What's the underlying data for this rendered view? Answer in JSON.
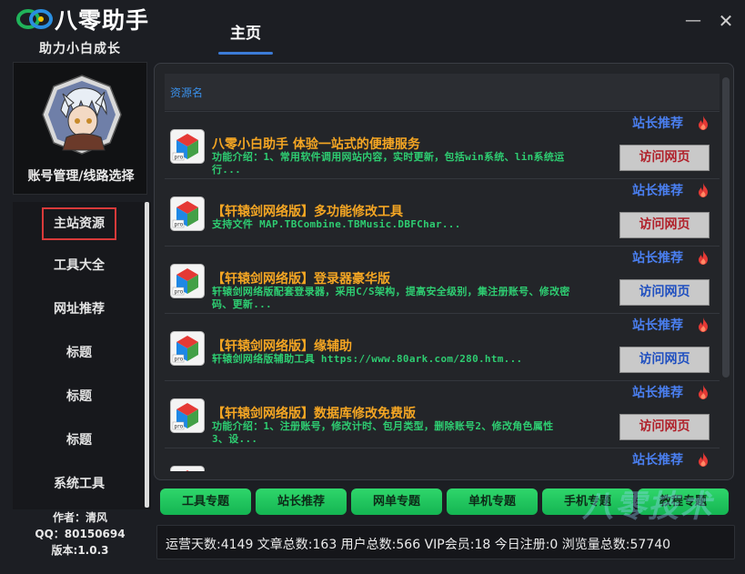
{
  "app": {
    "title": "八零助手",
    "slogan": "助力小白成长"
  },
  "header": {
    "tab_home": "主页"
  },
  "window": {
    "minimize": "—",
    "close": "✕"
  },
  "sidebar": {
    "profile_label": "账号管理/线路选择",
    "items": [
      {
        "label": "主站资源",
        "active": true
      },
      {
        "label": "工具大全"
      },
      {
        "label": "网址推荐"
      },
      {
        "label": "标题"
      },
      {
        "label": "标题"
      },
      {
        "label": "标题"
      },
      {
        "label": "系统工具"
      }
    ],
    "author_line": "作者：清风",
    "qq_line": "QQ：80150694",
    "version_line": "版本:1.0.3"
  },
  "list": {
    "header": "资源名",
    "rows": [
      {
        "title": "八零小白助手 体验一站式的便捷服务",
        "desc": "功能介绍：1、常用软件调用网站内容，实时更新，包括win系统、lin系统运\n行...",
        "recommend": "站长推荐",
        "button": "访问网页",
        "button_color": "red"
      },
      {
        "title": "【轩辕剑网络版】多功能修改工具",
        "desc": "支持文件 MAP.TBCombine.TBMusic.DBFChar...",
        "recommend": "站长推荐",
        "button": "访问网页",
        "button_color": "red"
      },
      {
        "title": "【轩辕剑网络版】登录器豪华版",
        "desc": "轩辕剑网络版配套登录器，采用C/S架构，提高安全级别，集注册账号、修改密\n码、更新...",
        "recommend": "站长推荐",
        "button": "访问网页",
        "button_color": "blue"
      },
      {
        "title": "【轩辕剑网络版】缘辅助",
        "desc": "轩辕剑网络版辅助工具 https://www.80ark.com/280.htm...",
        "recommend": "站长推荐",
        "button": "访问网页",
        "button_color": "blue"
      },
      {
        "title": "【轩辕剑网络版】数据库修改免费版",
        "desc": "功能介绍：1、注册账号，修改计时、包月类型，删除账号2、修改角色属性\n3、设...",
        "recommend": "站长推荐",
        "button": "访问网页",
        "button_color": "red"
      },
      {
        "title": "",
        "desc": "",
        "recommend": "站长推荐",
        "button": "",
        "button_color": "red"
      }
    ]
  },
  "bottom_buttons": [
    "工具专题",
    "站长推荐",
    "网单专题",
    "单机专题",
    "手机专题",
    "教程专题"
  ],
  "watermark": "八零技术",
  "status": "运营天数:4149  文章总数:163  用户总数:566  VIP会员:18  今日注册:0  浏览量总数:57740",
  "colors": {
    "accent": "#3c7bd6",
    "title_orange": "#f5a623",
    "desc_green": "#2ecc71",
    "recommend_blue": "#4a7ff0",
    "button_green": "#1fc55e",
    "active_border": "#d93a3a"
  }
}
